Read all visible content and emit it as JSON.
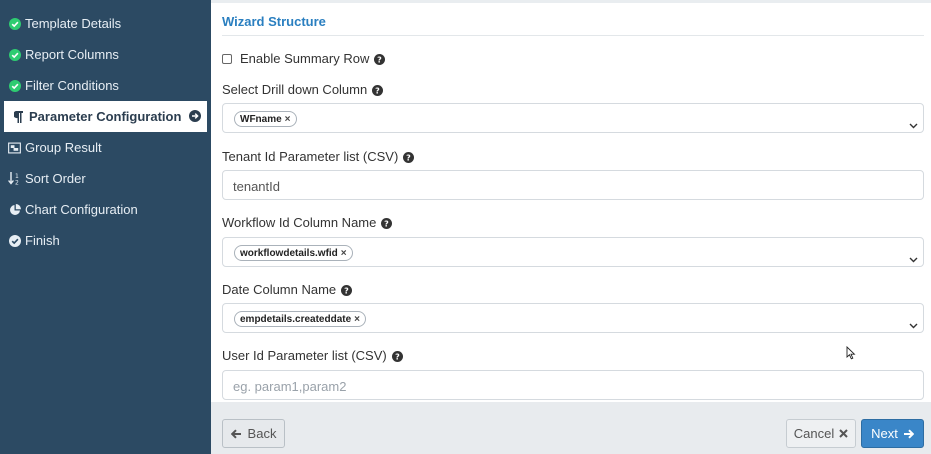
{
  "sidebar": {
    "items": [
      {
        "label": "Template Details",
        "icon": "check-circle-icon",
        "status": "done"
      },
      {
        "label": "Report Columns",
        "icon": "check-circle-icon",
        "status": "done"
      },
      {
        "label": "Filter Conditions",
        "icon": "check-circle-icon",
        "status": "done"
      },
      {
        "label": "Parameter Configuration",
        "icon": "paragraph-icon",
        "status": "active"
      },
      {
        "label": "Group Result",
        "icon": "object-group-icon",
        "status": "pending"
      },
      {
        "label": "Sort Order",
        "icon": "sort-numeric-icon",
        "status": "pending"
      },
      {
        "label": "Chart Configuration",
        "icon": "pie-chart-icon",
        "status": "pending"
      },
      {
        "label": "Finish",
        "icon": "check-circle-icon",
        "status": "pending"
      }
    ]
  },
  "wizard": {
    "title": "Wizard Structure"
  },
  "form": {
    "summary_row": {
      "label": "Enable Summary Row",
      "checked": false
    },
    "drilldown": {
      "label": "Select Drill down Column",
      "chip": "WFname"
    },
    "tenant": {
      "label": "Tenant Id Parameter list (CSV)",
      "value": "tenantId"
    },
    "workflow": {
      "label": "Workflow Id Column Name",
      "chip": "workflowdetails.wfid"
    },
    "date_col": {
      "label": "Date Column Name",
      "chip": "empdetails.createddate"
    },
    "user_id": {
      "label": "User Id Parameter list (CSV)",
      "placeholder": "eg. param1,param2"
    }
  },
  "footer": {
    "back_label": "Back",
    "cancel_label": "Cancel",
    "next_label": "Next"
  },
  "colors": {
    "sidebar_bg": "#2c4a63",
    "accent": "#2a7fc0",
    "done_green": "#27ae60",
    "next_btn": "#3a86c8"
  }
}
